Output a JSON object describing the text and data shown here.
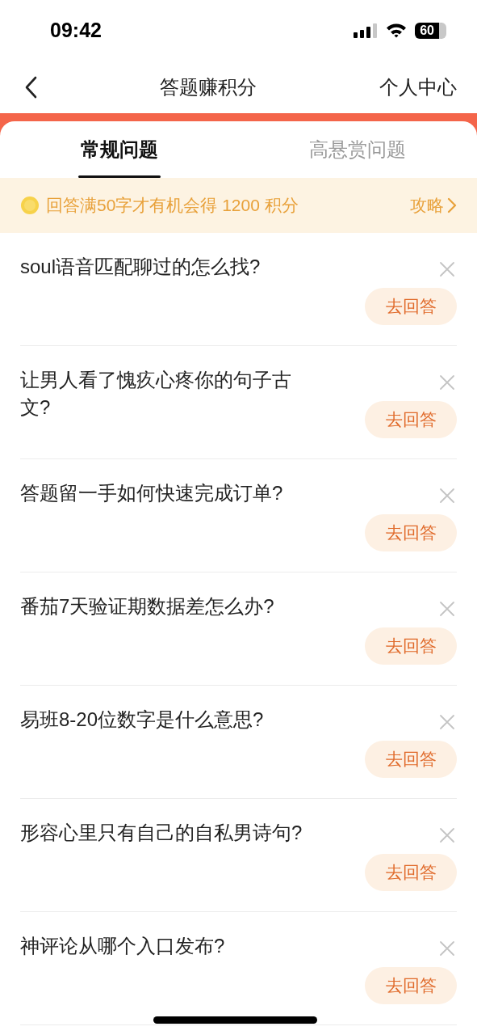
{
  "status_bar": {
    "time": "09:42",
    "battery": "60"
  },
  "nav": {
    "title": "答题赚积分",
    "right_link": "个人中心"
  },
  "tabs": [
    {
      "label": "常规问题",
      "selected": true
    },
    {
      "label": "高悬赏问题",
      "selected": false
    }
  ],
  "banner": {
    "text": "回答满50字才有机会得 1200 积分",
    "link": "攻略"
  },
  "questions": [
    {
      "text": "soul语音匹配聊过的怎么找?",
      "button": "去回答"
    },
    {
      "text": "让男人看了愧疚心疼你的句子古文?",
      "button": "去回答"
    },
    {
      "text": "答题留一手如何快速完成订单?",
      "button": "去回答"
    },
    {
      "text": "番茄7天验证期数据差怎么办?",
      "button": "去回答"
    },
    {
      "text": "易班8-20位数字是什么意思?",
      "button": "去回答"
    },
    {
      "text": "形容心里只有自己的自私男诗句?",
      "button": "去回答"
    },
    {
      "text": "神评论从哪个入口发布?",
      "button": "去回答"
    }
  ]
}
